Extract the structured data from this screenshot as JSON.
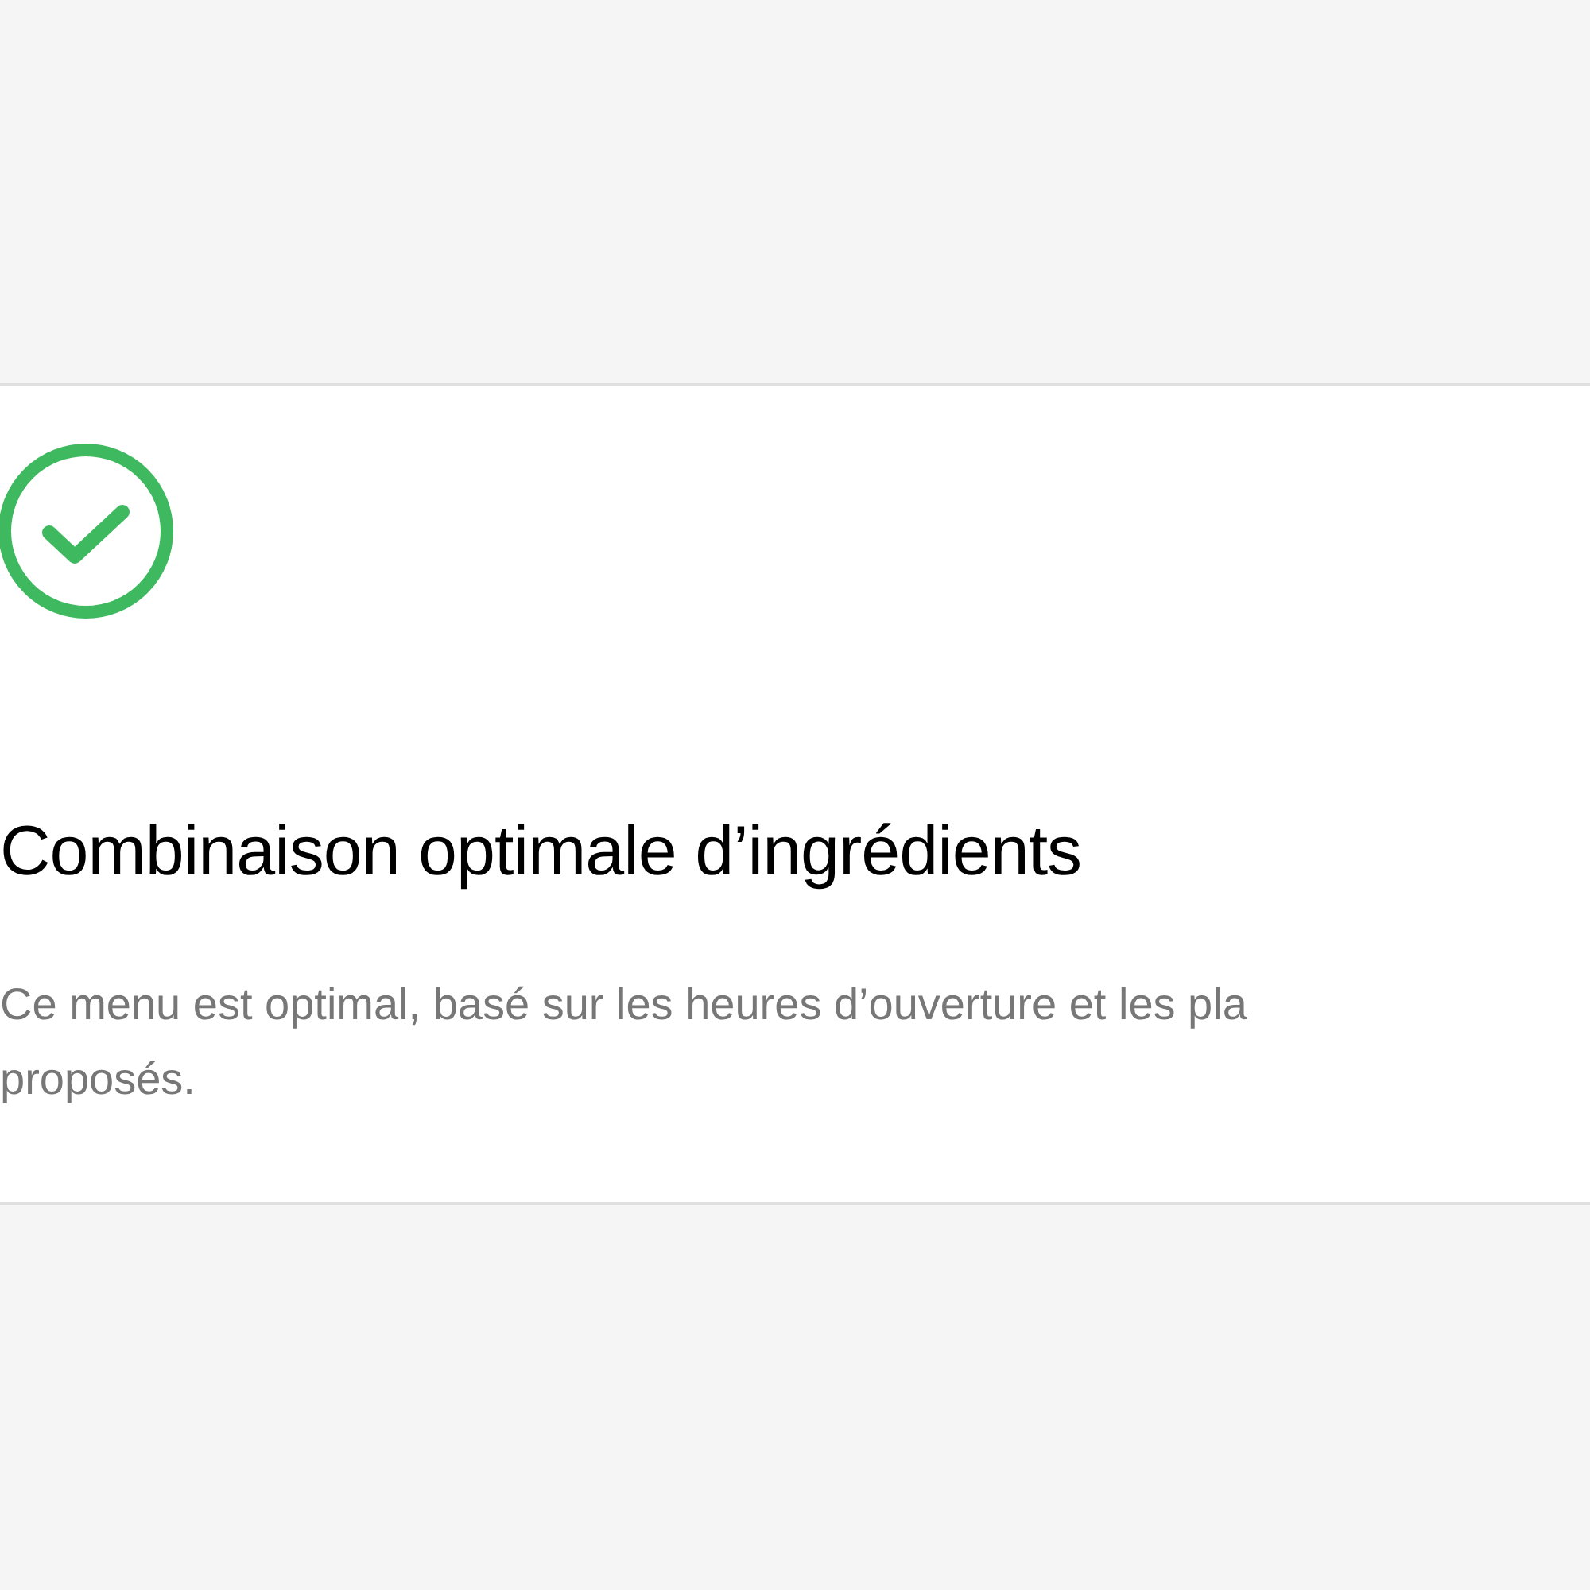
{
  "status": {
    "kind": "success"
  },
  "title": "Combinaison optimale d’ingrédients",
  "description": {
    "lines": [
      "Ce menu est optimal, basé sur les heures d’ouverture et les pla",
      "proposés."
    ]
  }
}
